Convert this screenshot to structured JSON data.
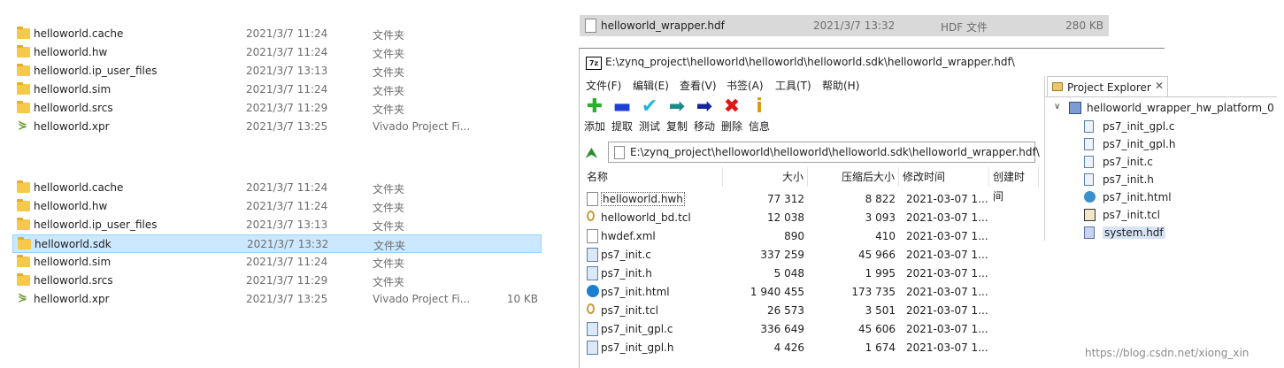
{
  "explorer_top": {
    "rows": [
      {
        "name": "helloworld.cache",
        "date": "2021/3/7 11:24",
        "type": "文件夹",
        "size": "",
        "icon": "folder-icon"
      },
      {
        "name": "helloworld.hw",
        "date": "2021/3/7 11:24",
        "type": "文件夹",
        "size": "",
        "icon": "folder-icon"
      },
      {
        "name": "helloworld.ip_user_files",
        "date": "2021/3/7 13:13",
        "type": "文件夹",
        "size": "",
        "icon": "folder-icon"
      },
      {
        "name": "helloworld.sim",
        "date": "2021/3/7 11:24",
        "type": "文件夹",
        "size": "",
        "icon": "folder-icon"
      },
      {
        "name": "helloworld.srcs",
        "date": "2021/3/7 11:29",
        "type": "文件夹",
        "size": "",
        "icon": "folder-icon"
      },
      {
        "name": "helloworld.xpr",
        "date": "2021/3/7 13:25",
        "type": "Vivado Project Fi...",
        "size": "",
        "icon": "vivado-icon"
      }
    ]
  },
  "explorer_bottom": {
    "rows": [
      {
        "name": "helloworld.cache",
        "date": "2021/3/7 11:24",
        "type": "文件夹",
        "size": "",
        "icon": "folder-icon"
      },
      {
        "name": "helloworld.hw",
        "date": "2021/3/7 11:24",
        "type": "文件夹",
        "size": "",
        "icon": "folder-icon"
      },
      {
        "name": "helloworld.ip_user_files",
        "date": "2021/3/7 13:13",
        "type": "文件夹",
        "size": "",
        "icon": "folder-icon"
      },
      {
        "name": "helloworld.sdk",
        "date": "2021/3/7 13:32",
        "type": "文件夹",
        "size": "",
        "icon": "folder-icon"
      },
      {
        "name": "helloworld.sim",
        "date": "2021/3/7 11:24",
        "type": "文件夹",
        "size": "",
        "icon": "folder-icon"
      },
      {
        "name": "helloworld.srcs",
        "date": "2021/3/7 11:29",
        "type": "文件夹",
        "size": "",
        "icon": "folder-icon"
      },
      {
        "name": "helloworld.xpr",
        "date": "2021/3/7 13:25",
        "type": "Vivado Project Fi...",
        "size": "10 KB",
        "icon": "vivado-icon"
      }
    ],
    "selected_name": "helloworld.sdk"
  },
  "hdf_row": {
    "name": "helloworld_wrapper.hdf",
    "date": "2021/3/7 13:32",
    "type": "HDF 文件",
    "size": "280 KB"
  },
  "archive": {
    "logo": "7z",
    "title": "E:\\zynq_project\\helloworld\\helloworld\\helloworld.sdk\\helloworld_wrapper.hdf\\",
    "menu": [
      "文件(F)",
      "编辑(E)",
      "查看(V)",
      "书签(A)",
      "工具(T)",
      "帮助(H)"
    ],
    "toolbar": [
      {
        "label": "添加",
        "glyph": "✚",
        "color": "#27b12b",
        "icon": "add-icon"
      },
      {
        "label": "提取",
        "glyph": "▬",
        "color": "#1b3fd8",
        "icon": "extract-icon"
      },
      {
        "label": "测试",
        "glyph": "✔",
        "color": "#21b6d9",
        "icon": "test-icon"
      },
      {
        "label": "复制",
        "glyph": "➡",
        "color": "#1c8a86",
        "icon": "copy-icon"
      },
      {
        "label": "移动",
        "glyph": "➡",
        "color": "#15249a",
        "icon": "move-icon"
      },
      {
        "label": "删除",
        "glyph": "✖",
        "color": "#e01515",
        "icon": "delete-icon"
      },
      {
        "label": "信息",
        "glyph": "i",
        "color": "#d89a0a",
        "icon": "info-icon"
      }
    ],
    "path": "E:\\zynq_project\\helloworld\\helloworld\\helloworld.sdk\\helloworld_wrapper.hdf\\",
    "columns": [
      "名称",
      "大小",
      "压缩后大小",
      "修改时间",
      "创建时间"
    ],
    "files": [
      {
        "name": "helloworld.hwh",
        "size": "77 312",
        "packed": "8 822",
        "modified": "2021-03-07 1...",
        "icon": "doc-icon"
      },
      {
        "name": "helloworld_bd.tcl",
        "size": "12 038",
        "packed": "3 093",
        "modified": "2021-03-07 1...",
        "icon": "tcl-icon"
      },
      {
        "name": "hwdef.xml",
        "size": "890",
        "packed": "410",
        "modified": "2021-03-07 1...",
        "icon": "doc-icon"
      },
      {
        "name": "ps7_init.c",
        "size": "337 259",
        "packed": "45 966",
        "modified": "2021-03-07 1...",
        "icon": "c-file-icon"
      },
      {
        "name": "ps7_init.h",
        "size": "5 048",
        "packed": "1 995",
        "modified": "2021-03-07 1...",
        "icon": "c-file-icon"
      },
      {
        "name": "ps7_init.html",
        "size": "1 940 455",
        "packed": "173 735",
        "modified": "2021-03-07 1...",
        "icon": "edge-icon"
      },
      {
        "name": "ps7_init.tcl",
        "size": "26 573",
        "packed": "3 501",
        "modified": "2021-03-07 1...",
        "icon": "tcl-icon"
      },
      {
        "name": "ps7_init_gpl.c",
        "size": "336 649",
        "packed": "45 606",
        "modified": "2021-03-07 1...",
        "icon": "c-file-icon"
      },
      {
        "name": "ps7_init_gpl.h",
        "size": "4 426",
        "packed": "1 674",
        "modified": "2021-03-07 1...",
        "icon": "c-file-icon"
      }
    ]
  },
  "project_explorer": {
    "tab_label": "Project Explorer",
    "root": "helloworld_wrapper_hw_platform_0",
    "children": [
      {
        "name": "ps7_init_gpl.c",
        "icon": "c-file-icon"
      },
      {
        "name": "ps7_init_gpl.h",
        "icon": "h-file-icon"
      },
      {
        "name": "ps7_init.c",
        "icon": "c-file-icon"
      },
      {
        "name": "ps7_init.h",
        "icon": "h-file-icon"
      },
      {
        "name": "ps7_init.html",
        "icon": "globe-icon"
      },
      {
        "name": "ps7_init.tcl",
        "icon": "tcl-icon"
      },
      {
        "name": "system.hdf",
        "icon": "hdf-icon"
      }
    ],
    "selected": "system.hdf"
  },
  "watermark": "https://blog.csdn.net/xiong_xin"
}
